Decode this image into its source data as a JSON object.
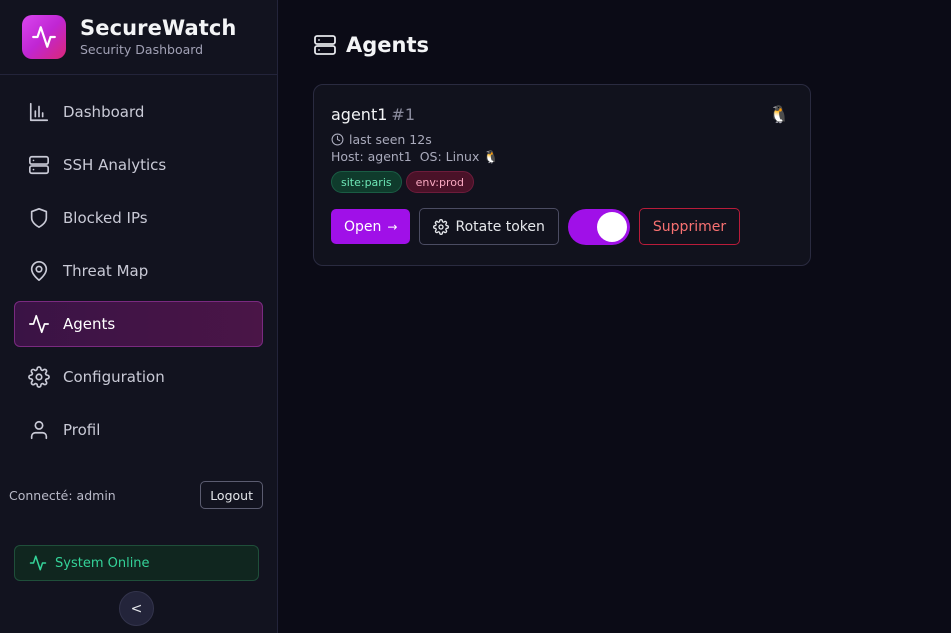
{
  "brand": {
    "title": "SecureWatch",
    "subtitle": "Security Dashboard",
    "logo_icon": "activity-icon"
  },
  "sidebar": {
    "items": [
      {
        "label": "Dashboard",
        "icon": "bar-chart-icon",
        "active": false
      },
      {
        "label": "SSH Analytics",
        "icon": "server-icon",
        "active": false
      },
      {
        "label": "Blocked IPs",
        "icon": "shield-icon",
        "active": false
      },
      {
        "label": "Threat Map",
        "icon": "map-pin-icon",
        "active": false
      },
      {
        "label": "Agents",
        "icon": "activity-icon",
        "active": true
      },
      {
        "label": "Configuration",
        "icon": "gear-icon",
        "active": false
      },
      {
        "label": "Profil",
        "icon": "user-icon",
        "active": false
      }
    ],
    "user_label": "Connecté: admin",
    "logout_label": "Logout",
    "status_label": "System Online",
    "collapse_label": "<"
  },
  "page": {
    "title": "Agents",
    "title_icon": "server-icon"
  },
  "agent": {
    "name": "agent1",
    "id": "#1",
    "os_glyph": "🐧",
    "last_seen": "last seen 12s",
    "host": "Host: agent1",
    "os": "OS: Linux 🐧",
    "tags": [
      "site:paris",
      "env:prod"
    ],
    "open_label": "Open",
    "open_arrow": "→",
    "rotate_label": "Rotate token",
    "enabled": true,
    "delete_label": "Supprimer"
  },
  "colors": {
    "accent": "#a010e8",
    "brand_gradient_start": "#d946ef",
    "brand_gradient_end": "#db2777",
    "online": "#34d399",
    "danger": "#f87171"
  }
}
